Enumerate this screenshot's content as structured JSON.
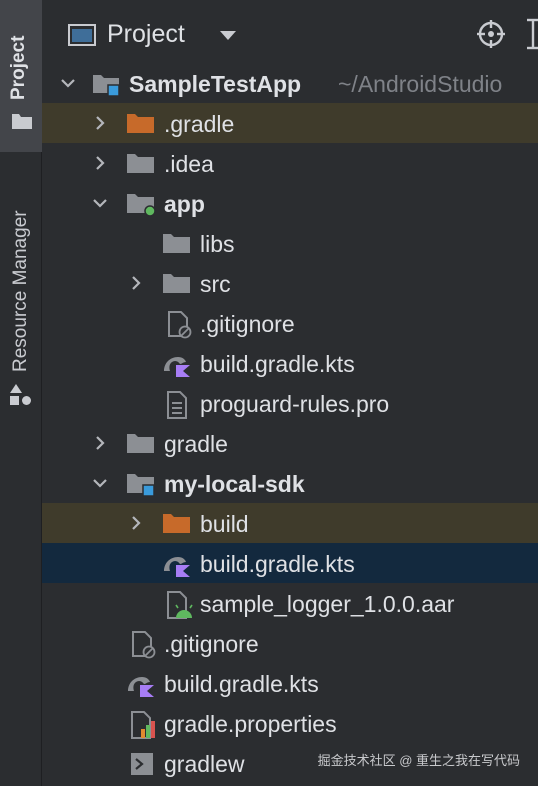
{
  "strip": {
    "project_label": "Project",
    "resource_manager_label": "Resource Manager"
  },
  "header": {
    "title": "Project"
  },
  "tree": [
    {
      "label": "SampleTestApp",
      "secondary": "~/AndroidStudio",
      "icon": "module-folder-icon",
      "expanded": true
    },
    {
      "label": ".gradle",
      "icon": "excluded-folder-icon",
      "expanded": false,
      "highlight": "yellow"
    },
    {
      "label": ".idea",
      "icon": "folder-icon",
      "expanded": false
    },
    {
      "label": "app",
      "icon": "android-module-folder-icon",
      "expanded": true
    },
    {
      "label": "libs",
      "icon": "folder-icon"
    },
    {
      "label": "src",
      "icon": "folder-icon",
      "expanded": false
    },
    {
      "label": ".gitignore",
      "icon": "ignore-file-icon"
    },
    {
      "label": "build.gradle.kts",
      "icon": "gradle-kotlin-file-icon"
    },
    {
      "label": "proguard-rules.pro",
      "icon": "text-file-icon"
    },
    {
      "label": "gradle",
      "icon": "folder-icon",
      "expanded": false
    },
    {
      "label": "my-local-sdk",
      "icon": "module-folder-icon",
      "expanded": true
    },
    {
      "label": "build",
      "icon": "excluded-folder-icon",
      "expanded": false,
      "highlight": "yellow"
    },
    {
      "label": "build.gradle.kts",
      "icon": "gradle-kotlin-file-icon",
      "selected": true
    },
    {
      "label": "sample_logger_1.0.0.aar",
      "icon": "aar-file-icon"
    },
    {
      "label": ".gitignore",
      "icon": "ignore-file-icon"
    },
    {
      "label": "build.gradle.kts",
      "icon": "gradle-kotlin-file-icon"
    },
    {
      "label": "gradle.properties",
      "icon": "properties-file-icon"
    },
    {
      "label": "gradlew",
      "icon": "script-file-icon"
    }
  ],
  "watermark": "掘金技术社区 @ 重生之我在写代码",
  "colors": {
    "selection": "#13293e",
    "excluded_highlight": "#3f3b2b",
    "excluded_folder": "#c76a2a",
    "module_badge": "#3a9bdc",
    "android_green": "#5fb85f",
    "kotlin_purple": "#a77df5"
  }
}
